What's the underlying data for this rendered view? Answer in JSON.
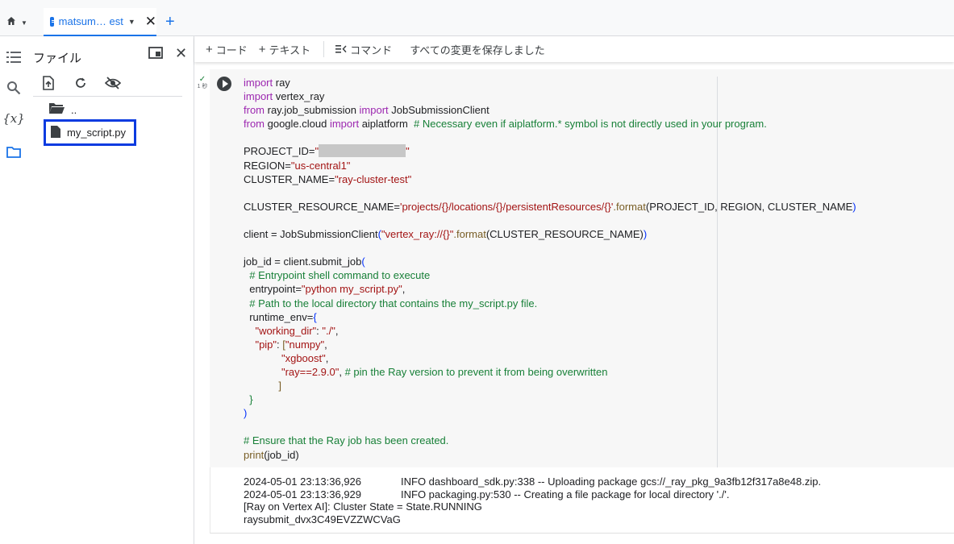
{
  "tabbar": {
    "home_icon": "home-icon",
    "tab_title": "matsum… est",
    "add_tab": "+"
  },
  "rail": {
    "icons": [
      "toc-icon",
      "search-icon",
      "variables-icon",
      "folder-icon"
    ],
    "variables_label": "{x}"
  },
  "files_panel": {
    "title": "ファイル",
    "parent_dir": "..",
    "files": [
      "my_script.py"
    ],
    "selected_file": "my_script.py",
    "tools": [
      "upload-icon",
      "refresh-icon",
      "hide-icon"
    ]
  },
  "toolbar": {
    "add_code": "コード",
    "add_text": "テキスト",
    "command": "コマンド",
    "save_status": "すべての変更を保存しました"
  },
  "cell": {
    "exec_check": "✓",
    "exec_time": "1 秒",
    "code_lines": [
      [
        {
          "t": "import",
          "c": "kw"
        },
        {
          "t": " ray"
        }
      ],
      [
        {
          "t": "import",
          "c": "kw"
        },
        {
          "t": " vertex_ray"
        }
      ],
      [
        {
          "t": "from",
          "c": "kw"
        },
        {
          "t": " ray.job_submission "
        },
        {
          "t": "import",
          "c": "kw"
        },
        {
          "t": " JobSubmissionClient"
        }
      ],
      [
        {
          "t": "from",
          "c": "kw"
        },
        {
          "t": " google.cloud "
        },
        {
          "t": "import",
          "c": "kw"
        },
        {
          "t": " aiplatform  "
        },
        {
          "t": "# Necessary even if aiplatform.* symbol is not directly used in your program.",
          "c": "cm"
        }
      ],
      [],
      [
        {
          "t": "PROJECT_ID="
        },
        {
          "t": "\"",
          "c": "str"
        },
        {
          "redact": true
        },
        {
          "t": "\"",
          "c": "str"
        }
      ],
      [
        {
          "t": "REGION="
        },
        {
          "t": "\"us-central1\"",
          "c": "str"
        }
      ],
      [
        {
          "t": "CLUSTER_NAME="
        },
        {
          "t": "\"ray-cluster-test\"",
          "c": "str"
        }
      ],
      [],
      [
        {
          "t": "CLUSTER_RESOURCE_NAME="
        },
        {
          "t": "'projects/{}/locations/{}/persistentResources/{}'",
          "c": "str"
        },
        {
          "t": ".format",
          "c": "fn"
        },
        {
          "t": "("
        },
        {
          "t": "PROJECT_ID, REGION, CLUSTER_NAME"
        },
        {
          "t": ")",
          "c": "br"
        }
      ],
      [],
      [
        {
          "t": "client = JobSubmissionClient"
        },
        {
          "t": "(",
          "c": "br"
        },
        {
          "t": "\"vertex_ray://{}\"",
          "c": "str"
        },
        {
          "t": ".format",
          "c": "fn"
        },
        {
          "t": "(CLUSTER_RESOURCE_NAME)"
        },
        {
          "t": ")",
          "c": "br"
        }
      ],
      [],
      [
        {
          "t": "job_id = client.submit_job"
        },
        {
          "t": "(",
          "c": "br"
        }
      ],
      [
        {
          "t": "  "
        },
        {
          "t": "# Entrypoint shell command to execute",
          "c": "cm"
        }
      ],
      [
        {
          "t": "  entrypoint="
        },
        {
          "t": "\"python my_script.py\"",
          "c": "str"
        },
        {
          "t": ","
        }
      ],
      [
        {
          "t": "  "
        },
        {
          "t": "# Path to the local directory that contains the my_script.py file.",
          "c": "cm"
        }
      ],
      [
        {
          "t": "  runtime_env="
        },
        {
          "t": "{",
          "c": "br"
        }
      ],
      [
        {
          "t": "    "
        },
        {
          "t": "\"working_dir\"",
          "c": "str"
        },
        {
          "t": ": "
        },
        {
          "t": "\"./\"",
          "c": "str"
        },
        {
          "t": ","
        }
      ],
      [
        {
          "t": "    "
        },
        {
          "t": "\"pip\"",
          "c": "str"
        },
        {
          "t": ": "
        },
        {
          "t": "[",
          "c": "fn"
        },
        {
          "t": "\"numpy\"",
          "c": "str"
        },
        {
          "t": ","
        }
      ],
      [
        {
          "t": "             "
        },
        {
          "t": "\"xgboost\"",
          "c": "str"
        },
        {
          "t": ","
        }
      ],
      [
        {
          "t": "             "
        },
        {
          "t": "\"ray==2.9.0\"",
          "c": "str"
        },
        {
          "t": ", "
        },
        {
          "t": "# pin the Ray version to prevent it from being overwritten",
          "c": "cm"
        }
      ],
      [
        {
          "t": "            "
        },
        {
          "t": "]",
          "c": "fn"
        }
      ],
      [
        {
          "t": "  "
        },
        {
          "t": "}",
          "c": "cm"
        }
      ],
      [
        {
          "t": ")",
          "c": "br"
        }
      ],
      [],
      [
        {
          "t": "# Ensure that the Ray job has been created.",
          "c": "cm"
        }
      ],
      [
        {
          "t": "print",
          "c": "fn"
        },
        {
          "t": "(job_id)"
        }
      ]
    ]
  },
  "output": {
    "lines": [
      {
        "ts": "2024-05-01 23:13:36,926",
        "msg": "INFO dashboard_sdk.py:338 -- Uploading package gcs://_ray_pkg_9a3fb12f317a8e48.zip."
      },
      {
        "ts": "2024-05-01 23:13:36,929",
        "msg": "INFO packaging.py:530 -- Creating a file package for local directory './'."
      },
      {
        "ts": "",
        "msg": "[Ray on Vertex AI]: Cluster State = State.RUNNING"
      },
      {
        "ts": "",
        "msg": "raysubmit_dvx3C49EVZZWCVaG"
      }
    ]
  }
}
